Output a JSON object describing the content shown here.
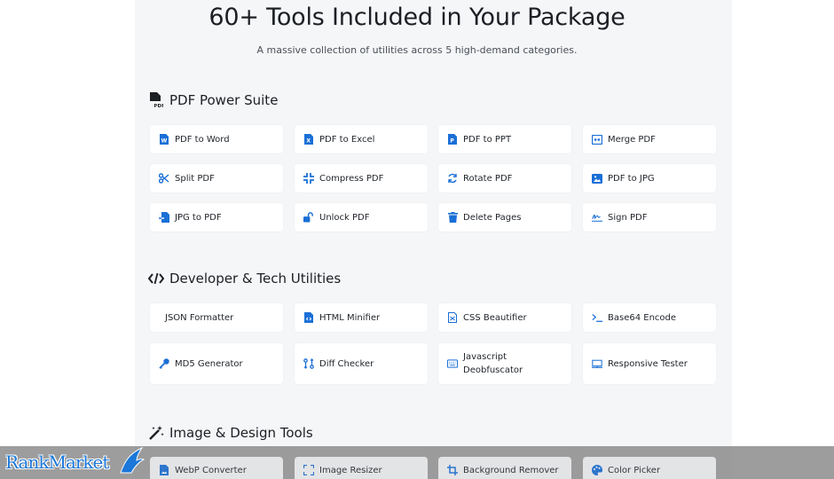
{
  "header": {
    "title": "60+ Tools Included in Your Package",
    "subtitle": "A massive collection of utilities across 5 high-demand categories."
  },
  "colors": {
    "icon_blue": "#1a6fd6",
    "panel_bg": "#f5f6f8",
    "card_bg": "#ffffff"
  },
  "sections": [
    {
      "title": "PDF Power Suite",
      "icon": "pdf-file-icon",
      "tools": [
        {
          "label": "PDF to Word",
          "icon": "word-file-icon"
        },
        {
          "label": "PDF to Excel",
          "icon": "excel-file-icon"
        },
        {
          "label": "PDF to PPT",
          "icon": "ppt-file-icon"
        },
        {
          "label": "Merge PDF",
          "icon": "merge-icon"
        },
        {
          "label": "Split PDF",
          "icon": "scissors-icon"
        },
        {
          "label": "Compress PDF",
          "icon": "compress-icon"
        },
        {
          "label": "Rotate PDF",
          "icon": "rotate-icon"
        },
        {
          "label": "PDF to JPG",
          "icon": "image-icon"
        },
        {
          "label": "JPG to PDF",
          "icon": "file-import-icon"
        },
        {
          "label": "Unlock PDF",
          "icon": "unlock-icon"
        },
        {
          "label": "Delete Pages",
          "icon": "trash-icon"
        },
        {
          "label": "Sign PDF",
          "icon": "signature-icon"
        }
      ]
    },
    {
      "title": "Developer & Tech Utilities",
      "icon": "code-icon",
      "tools": [
        {
          "label": "JSON Formatter",
          "icon": ""
        },
        {
          "label": "HTML Minifier",
          "icon": "html-file-icon"
        },
        {
          "label": "CSS Beautifier",
          "icon": "css-file-icon"
        },
        {
          "label": "Base64 Encode",
          "icon": "terminal-icon"
        },
        {
          "label": "MD5 Generator",
          "icon": "key-icon"
        },
        {
          "label": "Diff Checker",
          "icon": "diff-icon"
        },
        {
          "label": "Javascript Deobfuscator",
          "icon": "keyboard-icon"
        },
        {
          "label": "Responsive Tester",
          "icon": "monitor-icon"
        }
      ]
    },
    {
      "title": "Image & Design Tools",
      "icon": "magic-wand-icon",
      "tools": [
        {
          "label": "WebP Converter",
          "icon": "file-image-icon"
        },
        {
          "label": "Image Resizer",
          "icon": "resize-icon"
        },
        {
          "label": "Background Remover",
          "icon": "crop-icon"
        },
        {
          "label": "Color Picker",
          "icon": "palette-icon"
        }
      ]
    }
  ],
  "watermark": {
    "text": "RankMarket"
  }
}
